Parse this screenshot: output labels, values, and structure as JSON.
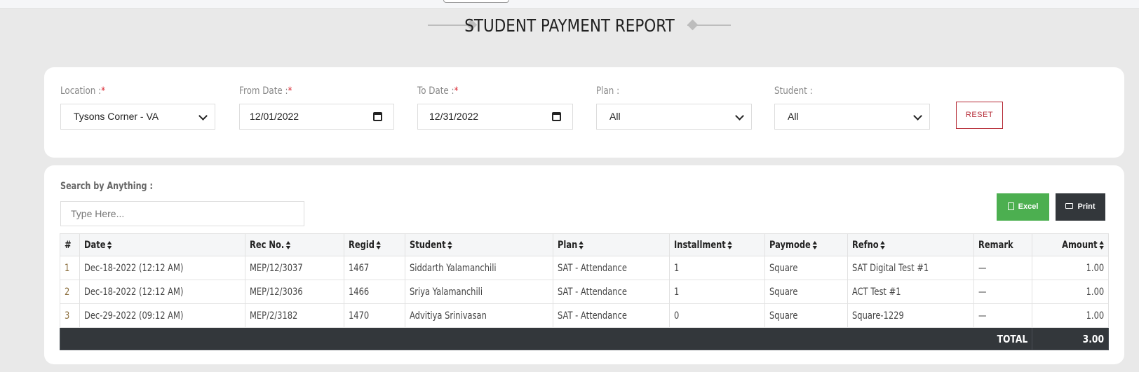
{
  "page": {
    "title": "STUDENT PAYMENT REPORT"
  },
  "filters": {
    "location": {
      "label": "Location :",
      "required": "*",
      "value": "Tysons Corner - VA"
    },
    "from_date": {
      "label": "From Date :",
      "required": "*",
      "value": "12/01/2022"
    },
    "to_date": {
      "label": "To Date :",
      "required": "*",
      "value": "12/31/2022"
    },
    "plan": {
      "label": "Plan :",
      "value": "All"
    },
    "student": {
      "label": "Student :",
      "value": "All"
    },
    "reset_label": "RESET"
  },
  "search": {
    "label": "Search by Anything :",
    "placeholder": "Type Here..."
  },
  "actions": {
    "excel_label": "Excel",
    "print_label": "Print"
  },
  "table": {
    "headers": [
      "#",
      "Date",
      "Rec No.",
      "Regid",
      "Student",
      "Plan",
      "Installment",
      "Paymode",
      "Refno",
      "Remark",
      "Amount"
    ],
    "rows": [
      {
        "num": "1",
        "date": "Dec-18-2022 (12:12 AM)",
        "rec": "MEP/12/3037",
        "regid": "1467",
        "student": "Siddarth Yalamanchili",
        "plan": "SAT - Attendance",
        "installment": "1",
        "paymode": "Square",
        "refno": "SAT Digital Test #1",
        "remark": "—",
        "amount": "1.00"
      },
      {
        "num": "2",
        "date": "Dec-18-2022 (12:12 AM)",
        "rec": "MEP/12/3036",
        "regid": "1466",
        "student": "Sriya Yalamanchili",
        "plan": "SAT - Attendance",
        "installment": "1",
        "paymode": "Square",
        "refno": "ACT Test #1",
        "remark": "—",
        "amount": "1.00"
      },
      {
        "num": "3",
        "date": "Dec-29-2022 (09:12 AM)",
        "rec": "MEP/2/3182",
        "regid": "1470",
        "student": "Advitiya Srinivasan",
        "plan": "SAT - Attendance",
        "installment": "0",
        "paymode": "Square",
        "refno": "Square-1229",
        "remark": "—",
        "amount": "1.00"
      }
    ],
    "total_label": "TOTAL",
    "total_value": "3.00"
  },
  "icons": {
    "excel": "excel-file-icon",
    "print": "printer-icon",
    "sort": "sort-icon",
    "dropdown": "chevron-down-icon",
    "calendar": "calendar-icon"
  },
  "colors": {
    "excel": "#4caf50",
    "print": "#33373b",
    "reset": "#b52a35",
    "required": "#d9232d",
    "total_bg": "#33373b"
  }
}
